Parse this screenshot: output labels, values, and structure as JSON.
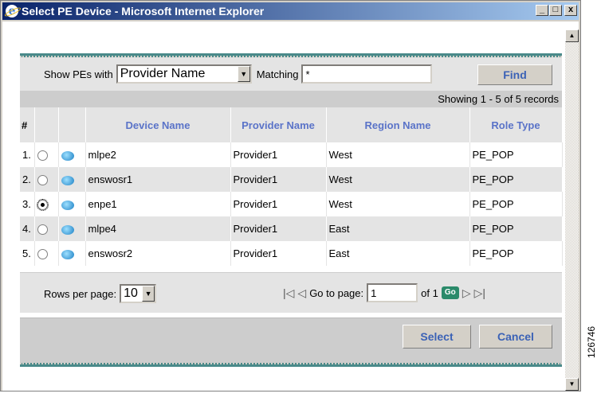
{
  "window": {
    "title": "Select PE Device - Microsoft Internet Explorer",
    "minimize": "_",
    "maximize": "□",
    "close": "x"
  },
  "filter": {
    "show_label": "Show PEs with",
    "field_value": "Provider Name",
    "matching_label": "Matching",
    "matching_value": "*",
    "find_label": "Find"
  },
  "records": {
    "showing": "Showing 1 - 5 of 5 records"
  },
  "table": {
    "headers": {
      "num": "#",
      "device": "Device Name",
      "provider": "Provider Name",
      "region": "Region Name",
      "role": "Role Type"
    },
    "rows": [
      {
        "num": "1.",
        "device": "mlpe2",
        "provider": "Provider1",
        "region": "West",
        "role": "PE_POP",
        "selected": false
      },
      {
        "num": "2.",
        "device": "enswosr1",
        "provider": "Provider1",
        "region": "West",
        "role": "PE_POP",
        "selected": false
      },
      {
        "num": "3.",
        "device": "enpe1",
        "provider": "Provider1",
        "region": "West",
        "role": "PE_POP",
        "selected": true
      },
      {
        "num": "4.",
        "device": "mlpe4",
        "provider": "Provider1",
        "region": "East",
        "role": "PE_POP",
        "selected": false
      },
      {
        "num": "5.",
        "device": "enswosr2",
        "provider": "Provider1",
        "region": "East",
        "role": "PE_POP",
        "selected": false
      }
    ]
  },
  "pager": {
    "rows_label": "Rows per page:",
    "rows_value": "10",
    "goto_label": "Go to page:",
    "page_value": "1",
    "of_label": "of 1",
    "go_label": "Go"
  },
  "actions": {
    "select": "Select",
    "cancel": "Cancel"
  },
  "figure_id": "126746"
}
